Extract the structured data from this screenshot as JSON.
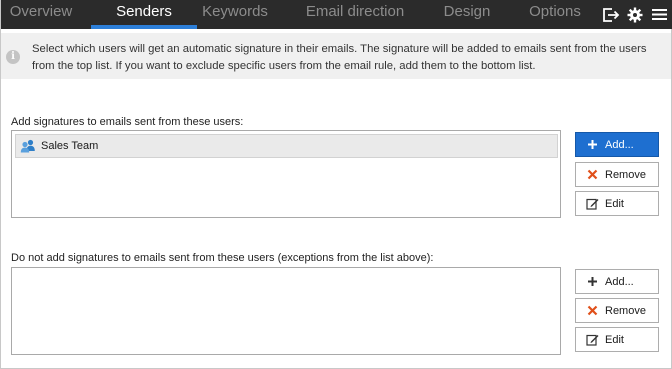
{
  "tabs": [
    {
      "label": "Overview",
      "active": false
    },
    {
      "label": "Senders",
      "active": true
    },
    {
      "label": "Keywords",
      "active": false
    },
    {
      "label": "Email direction",
      "active": false
    },
    {
      "label": "Design",
      "active": false
    },
    {
      "label": "Options",
      "active": false
    }
  ],
  "top_icons": [
    "exit-icon",
    "gear-icon",
    "hamburger-menu-icon"
  ],
  "info": {
    "icon": "info-icon",
    "text": "Select which users will get an automatic signature in their emails. The signature will be added to emails sent from the users from the top list. If you want to exclude specific users from the email rule, add them to the bottom list."
  },
  "include_section": {
    "label": "Add signatures to emails sent from these users:",
    "items": [
      {
        "label": "Sales Team",
        "icon": "user-group-icon"
      }
    ],
    "buttons": {
      "add": "Add...",
      "remove": "Remove",
      "edit": "Edit"
    }
  },
  "exclude_section": {
    "label": "Do not add signatures to emails sent from these users (exceptions from the list above):",
    "items": [],
    "buttons": {
      "add": "Add...",
      "remove": "Remove",
      "edit": "Edit"
    }
  },
  "colors": {
    "tabbar_bg": "#2b2b2b",
    "active_tab_indicator": "#2d7fd8",
    "primary_button": "#1e6fd0",
    "remove_icon": "#e0501a"
  }
}
